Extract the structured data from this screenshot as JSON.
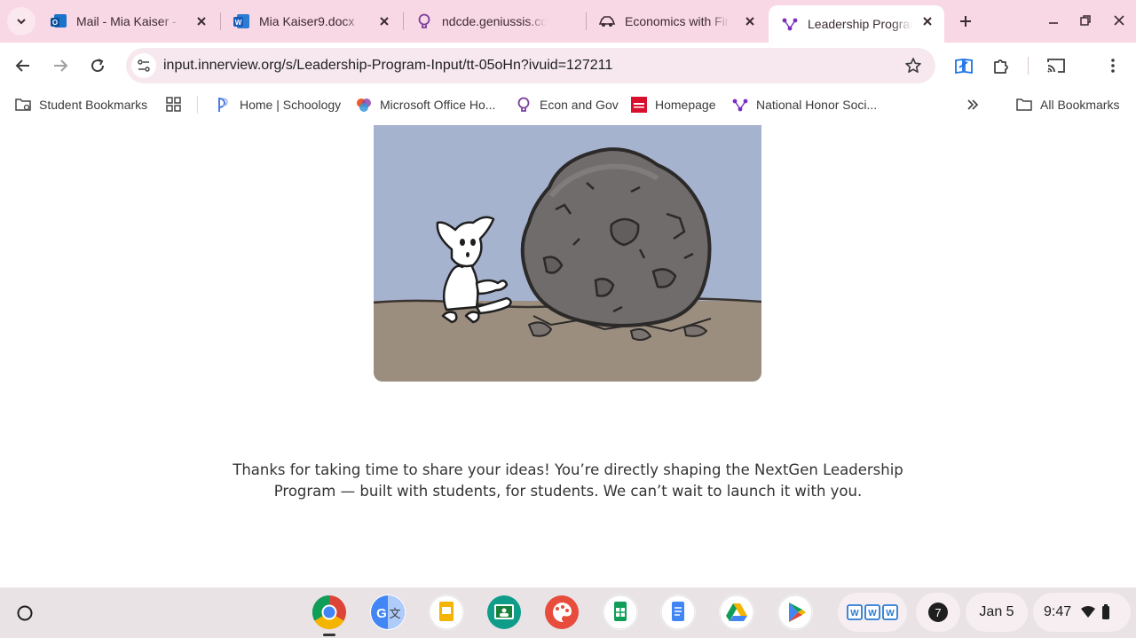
{
  "tabs": [
    {
      "title": "Mail - Mia Kaiser - Outlook",
      "icon": "outlook-icon"
    },
    {
      "title": "Mia Kaiser9.docx",
      "icon": "word-icon"
    },
    {
      "title": "ndcde.geniussis.com",
      "icon": "lightbulb-icon"
    },
    {
      "title": "Economics with Financial Literacy",
      "icon": "car-icon"
    },
    {
      "title": "Leadership Program Input",
      "icon": "innerview-icon",
      "active": true
    }
  ],
  "toolbar": {
    "url": "input.innerview.org/s/Leadership-Program-Input/tt-05oHn?ivuid=127211"
  },
  "bookmarks": [
    {
      "label": "Student Bookmarks",
      "icon": "folder-managed-icon"
    },
    {
      "label": "",
      "icon": "apps-grid-icon"
    },
    {
      "label": "Home | Schoology",
      "icon": "schoology-icon"
    },
    {
      "label": "Microsoft Office Ho...",
      "icon": "microsoft-office-icon"
    },
    {
      "label": "Econ and Gov",
      "icon": "lightbulb-icon"
    },
    {
      "label": "Homepage",
      "icon": "homepage-icon"
    },
    {
      "label": "National Honor Soci...",
      "icon": "innerview-icon"
    },
    {
      "label": "All Bookmarks",
      "icon": "folder-icon"
    }
  ],
  "content": {
    "message_line1": "Thanks for taking  time to share your ideas! You’re directly shaping the NextGen Leadership",
    "message_line2": "Program — built with students, for students. We can’t wait to launch it with you."
  },
  "shelf": {
    "apps": [
      "Chrome",
      "Google Translate",
      "Google Slides",
      "Google Classroom",
      "Canvas",
      "Google Sheets",
      "Google Docs",
      "Google Drive",
      "Play Store"
    ],
    "notification_count": "7",
    "date": "Jan 5",
    "time": "9:47"
  },
  "colors": {
    "tabstrip": "#f8d8e4",
    "omnibox": "#f6e8ee",
    "sky": "#a6b3cf",
    "ground": "#9b8e7f",
    "shelf": "#e9e3e6"
  }
}
